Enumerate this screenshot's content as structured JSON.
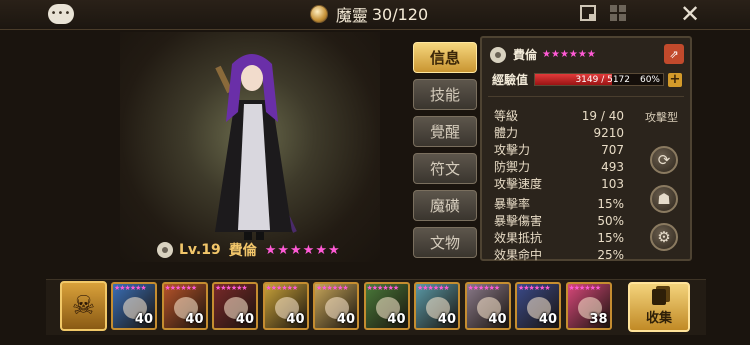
{
  "topbar": {
    "chat_icon": "chat-bubble-icon",
    "mana_icon": "mana-crystal-icon",
    "mana_label": "魔靈",
    "mana_value": "30/120",
    "close_label": "✕"
  },
  "character": {
    "level_text": "Lv.19",
    "name": "費倫",
    "stars": "★★★★★★",
    "star_count": 6
  },
  "tabs": [
    {
      "label": "信息",
      "active": true
    },
    {
      "label": "技能",
      "active": false
    },
    {
      "label": "覺醒",
      "active": false
    },
    {
      "label": "符文",
      "active": false
    },
    {
      "label": "魔磺",
      "active": false
    },
    {
      "label": "文物",
      "active": false
    }
  ],
  "panel": {
    "name": "費倫",
    "stars": "★★★★★★",
    "exp_label": "經驗值",
    "exp_value": "3149 / 5172",
    "exp_percent": "60%",
    "exp_fraction": 0.6,
    "type_label": "攻擊型",
    "stats": [
      {
        "label": "等級",
        "value": "19 / 40"
      },
      {
        "label": "體力",
        "value": "9210"
      },
      {
        "label": "攻擊力",
        "value": "707"
      },
      {
        "label": "防禦力",
        "value": "493"
      },
      {
        "label": "攻擊速度",
        "value": "103"
      }
    ],
    "stats2": [
      {
        "label": "暴擊率",
        "value": "15%"
      },
      {
        "label": "暴擊傷害",
        "value": "50%"
      },
      {
        "label": "效果抵抗",
        "value": "15%"
      },
      {
        "label": "效果命中",
        "value": "25%"
      }
    ]
  },
  "roster": {
    "leader_icon": "leader-skill-icon",
    "monsters": [
      {
        "level": "40",
        "stars": "★★★★★★",
        "color": "#3a6fb8"
      },
      {
        "level": "40",
        "stars": "★★★★★★",
        "color": "#b8542a"
      },
      {
        "level": "40",
        "stars": "★★★★★★",
        "color": "#7a2a2a"
      },
      {
        "level": "40",
        "stars": "★★★★★★",
        "color": "#c9a23a"
      },
      {
        "level": "40",
        "stars": "★★★★★★",
        "color": "#c7a65a"
      },
      {
        "level": "40",
        "stars": "★★★★★★",
        "color": "#4a7a3a"
      },
      {
        "level": "40",
        "stars": "★★★★★★",
        "color": "#5a9aa8"
      },
      {
        "level": "40",
        "stars": "★★★★★★",
        "color": "#8a7a8a"
      },
      {
        "level": "40",
        "stars": "★★★★★★",
        "color": "#3a4a8a"
      },
      {
        "level": "38",
        "stars": "★★★★★★",
        "color": "#d8487a"
      }
    ],
    "collect_label": "收集"
  }
}
